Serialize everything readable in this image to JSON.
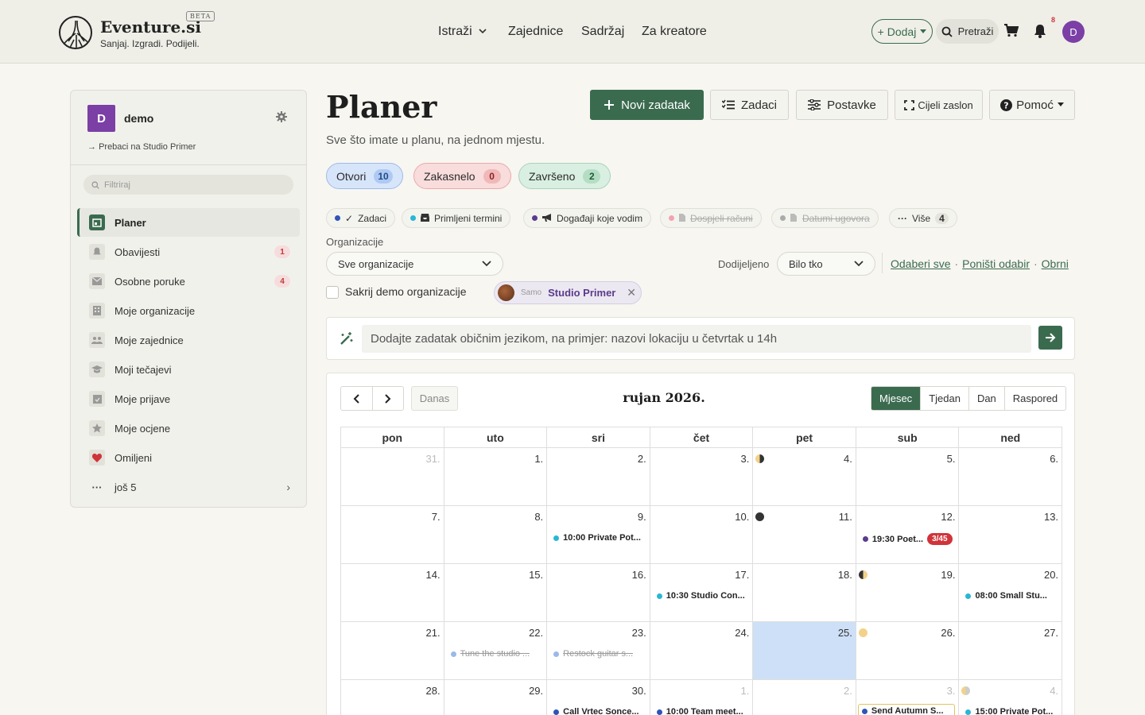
{
  "header": {
    "brand": "Eventure.si",
    "beta": "BETA",
    "tagline": "Sanjaj. Izgradi. Podijeli.",
    "nav": [
      "Istraži",
      "Zajednice",
      "Sadržaj",
      "Za kreatore"
    ],
    "add_label": "+ Dodaj",
    "search_label": "Pretraži",
    "notification_count": "8",
    "avatar_letter": "D"
  },
  "sidebar": {
    "workspace_letter": "D",
    "workspace_name": "demo",
    "switch_label": "Prebaci na Studio Primer",
    "filter_placeholder": "Filtriraj",
    "items": [
      {
        "label": "Planer",
        "icon": "calendar-icon"
      },
      {
        "label": "Obavijesti",
        "icon": "bell-icon",
        "badge": "1"
      },
      {
        "label": "Osobne poruke",
        "icon": "envelope-icon",
        "badge": "4"
      },
      {
        "label": "Moje organizacije",
        "icon": "building-icon"
      },
      {
        "label": "Moje zajednice",
        "icon": "people-icon"
      },
      {
        "label": "Moji tečajevi",
        "icon": "graduation-cap-icon"
      },
      {
        "label": "Moje prijave",
        "icon": "calendar-check-icon"
      },
      {
        "label": "Moje ocjene",
        "icon": "star-icon"
      },
      {
        "label": "Omiljeni",
        "icon": "heart-icon"
      },
      {
        "label": "još 5",
        "icon": "ellipsis-icon"
      }
    ]
  },
  "main": {
    "title": "Planer",
    "subtitle": "Sve što imate u planu, na jednom mjestu.",
    "toolbar": {
      "new_task": "Novi zadatak",
      "tasks": "Zadaci",
      "settings": "Postavke",
      "fullscreen": "Cijeli zaslon",
      "help": "Pomoć"
    },
    "status_pills": [
      {
        "label": "Otvori",
        "count": "10",
        "color": "#cfe0fa"
      },
      {
        "label": "Zakasnelo",
        "count": "0",
        "color": "#f8d7d7"
      },
      {
        "label": "Završeno",
        "count": "2",
        "color": "#d3ecdc"
      }
    ],
    "filters": [
      {
        "label": "Zadaci",
        "dot": "#2f54b8",
        "active": true
      },
      {
        "label": "Primljeni termini",
        "dot": "#2ab6d4",
        "active": true
      },
      {
        "label": "Događaji koje vodim",
        "dot": "#5a3b8c",
        "active": true
      },
      {
        "label": "Dospjeli računi",
        "dot": "#f1a4b0",
        "active": false
      },
      {
        "label": "Datumi ugovora",
        "dot": "#aaaaaa",
        "active": false
      },
      {
        "label": "Više",
        "count": "4"
      }
    ],
    "org_label": "Organizacije",
    "org_value": "Sve organizacije",
    "assign_label": "Dodijeljeno",
    "assign_value": "Bilo tko",
    "links": [
      "Odaberi sve",
      "Poništi odabir",
      "Obrni"
    ],
    "hide_demo_label": "Sakrij demo organizacije",
    "org_chip": {
      "prefix": "Samo",
      "name": "Studio Primer"
    },
    "ai_placeholder": "Dodajte zadatak običnim jezikom, na primjer: nazovi lokaciju u četvrtak u 14h"
  },
  "calendar": {
    "title": "rujan 2026.",
    "today_label": "Danas",
    "views": [
      "Mjesec",
      "Tjedan",
      "Dan",
      "Raspored"
    ],
    "active_view": "Mjesec",
    "weekdays": [
      "pon",
      "uto",
      "sri",
      "čet",
      "pet",
      "sub",
      "ned"
    ],
    "weeks": [
      [
        {
          "d": "31.",
          "mute": true
        },
        {
          "d": "1."
        },
        {
          "d": "2."
        },
        {
          "d": "3."
        },
        {
          "d": "4.",
          "moon": "first-quarter"
        },
        {
          "d": "5."
        },
        {
          "d": "6."
        }
      ],
      [
        {
          "d": "7."
        },
        {
          "d": "8."
        },
        {
          "d": "9.",
          "evt": "10:00 Private Pot...",
          "dot": "#2ab6d4"
        },
        {
          "d": "10."
        },
        {
          "d": "11.",
          "moon": "new"
        },
        {
          "d": "12.",
          "evt": "19:30 Poet...",
          "dot": "#5a3b8c",
          "badge": "3/45"
        },
        {
          "d": "13."
        }
      ],
      [
        {
          "d": "14."
        },
        {
          "d": "15."
        },
        {
          "d": "16."
        },
        {
          "d": "17.",
          "evt": "10:30 Studio Con...",
          "dot": "#2ab6d4"
        },
        {
          "d": "18."
        },
        {
          "d": "19.",
          "moon": "first-quarter-alt"
        },
        {
          "d": "20.",
          "evt": "08:00 Small Stu...",
          "dot": "#2ab6d4"
        }
      ],
      [
        {
          "d": "21."
        },
        {
          "d": "22.",
          "evt": "Tune the studio ...",
          "dot": "#9bb8ea",
          "done": true
        },
        {
          "d": "23.",
          "evt": "Restock guitar s...",
          "dot": "#9bb8ea",
          "done": true
        },
        {
          "d": "24."
        },
        {
          "d": "25.",
          "highlight": true
        },
        {
          "d": "26.",
          "moon": "full"
        },
        {
          "d": "27."
        }
      ],
      [
        {
          "d": "28."
        },
        {
          "d": "29."
        },
        {
          "d": "30.",
          "evt": "Call Vrtec Sonce...",
          "dot": "#2f54b8"
        },
        {
          "d": "1.",
          "mute": true,
          "evt": "10:00 Team meet...",
          "dot": "#2f54b8"
        },
        {
          "d": "2.",
          "mute": true
        },
        {
          "d": "3.",
          "mute": true,
          "evt": "Send Autumn S...",
          "dot": "#2f54b8",
          "boxed": true
        },
        {
          "d": "4.",
          "mute": true,
          "moon": "last-quarter",
          "evt": "15:00 Private Pot...",
          "dot": "#2ab6d4"
        }
      ]
    ]
  },
  "colors": {
    "accent": "#3b6b4f",
    "purple": "#7b3fa6",
    "highlight": "#cde0f7",
    "danger": "#d0343a"
  }
}
